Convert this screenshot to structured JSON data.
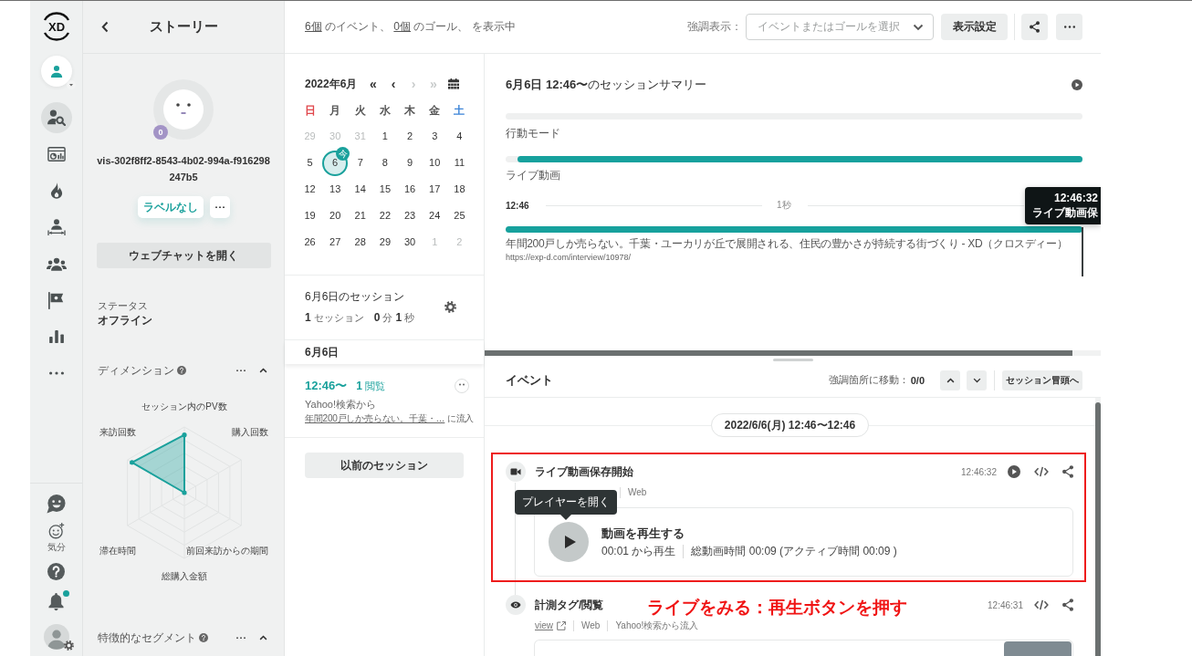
{
  "side_rail": {
    "logo": "XD",
    "nav": [
      {
        "selected": true
      },
      {
        "selected": false
      },
      {
        "selected": false
      },
      {
        "selected": false
      },
      {
        "selected": false
      },
      {
        "selected": false
      },
      {
        "selected": false
      },
      {
        "selected": false
      }
    ],
    "mood_label": "気分",
    "unread_notifications": true
  },
  "story_panel": {
    "title": "ストーリー",
    "visitor_id": "vis-302f8ff2-8543-4b02-994a-f916298247b5",
    "visit_count": "0",
    "label_button": "ラベルなし",
    "chat_button": "ウェブチャットを開く",
    "status": {
      "label": "ステータス",
      "value": "オフライン"
    },
    "dimensions": {
      "title": "ディメンション",
      "expanded": true,
      "axes": [
        "セッション内のPV数",
        "購入回数",
        "前回来訪からの期間",
        "総購入金額",
        "滞在時間",
        "来訪回数"
      ]
    },
    "segments": {
      "title": "特徴的なセグメント",
      "expanded": true
    }
  },
  "top_bar": {
    "summary": [
      {
        "kind": "link",
        "text": "6個"
      },
      {
        "kind": "text",
        "text": " のイベント、 "
      },
      {
        "kind": "link",
        "text": "0個"
      },
      {
        "kind": "text",
        "text": " のゴール、 を表示中"
      }
    ],
    "highlight_label": "強調表示：",
    "highlight_select": {
      "placeholder": "イベントまたはゴールを選択"
    },
    "settings_button": "表示設定"
  },
  "calendar": {
    "title": "2022年6月",
    "nav": [
      {
        "text": "«",
        "disabled": false
      },
      {
        "text": "‹",
        "disabled": false
      },
      {
        "text": "›",
        "disabled": true
      },
      {
        "text": "»",
        "disabled": true
      }
    ],
    "weekdays": [
      {
        "text": "日",
        "color": "#e0474c"
      },
      {
        "text": "月",
        "color": "#555555"
      },
      {
        "text": "火",
        "color": "#555555"
      },
      {
        "text": "水",
        "color": "#555555"
      },
      {
        "text": "木",
        "color": "#555555"
      },
      {
        "text": "金",
        "color": "#555555"
      },
      {
        "text": "土",
        "color": "#3d85d8"
      }
    ],
    "today_badge": "今",
    "days": [
      {
        "text": "29",
        "outside": true,
        "selected": false,
        "today": false
      },
      {
        "text": "30",
        "outside": true,
        "selected": false,
        "today": false
      },
      {
        "text": "31",
        "outside": true,
        "selected": false,
        "today": false
      },
      {
        "text": "1",
        "outside": false,
        "selected": false,
        "today": false
      },
      {
        "text": "2",
        "outside": false,
        "selected": false,
        "today": false
      },
      {
        "text": "3",
        "outside": false,
        "selected": false,
        "today": false
      },
      {
        "text": "4",
        "outside": false,
        "selected": false,
        "today": false
      },
      {
        "text": "5",
        "outside": false,
        "selected": false,
        "today": false
      },
      {
        "text": "6",
        "outside": false,
        "selected": true,
        "today": true
      },
      {
        "text": "7",
        "outside": false,
        "selected": false,
        "today": false
      },
      {
        "text": "8",
        "outside": false,
        "selected": false,
        "today": false
      },
      {
        "text": "9",
        "outside": false,
        "selected": false,
        "today": false
      },
      {
        "text": "10",
        "outside": false,
        "selected": false,
        "today": false
      },
      {
        "text": "11",
        "outside": false,
        "selected": false,
        "today": false
      },
      {
        "text": "12",
        "outside": false,
        "selected": false,
        "today": false
      },
      {
        "text": "13",
        "outside": false,
        "selected": false,
        "today": false
      },
      {
        "text": "14",
        "outside": false,
        "selected": false,
        "today": false
      },
      {
        "text": "15",
        "outside": false,
        "selected": false,
        "today": false
      },
      {
        "text": "16",
        "outside": false,
        "selected": false,
        "today": false
      },
      {
        "text": "17",
        "outside": false,
        "selected": false,
        "today": false
      },
      {
        "text": "18",
        "outside": false,
        "selected": false,
        "today": false
      },
      {
        "text": "19",
        "outside": false,
        "selected": false,
        "today": false
      },
      {
        "text": "20",
        "outside": false,
        "selected": false,
        "today": false
      },
      {
        "text": "21",
        "outside": false,
        "selected": false,
        "today": false
      },
      {
        "text": "22",
        "outside": false,
        "selected": false,
        "today": false
      },
      {
        "text": "23",
        "outside": false,
        "selected": false,
        "today": false
      },
      {
        "text": "24",
        "outside": false,
        "selected": false,
        "today": false
      },
      {
        "text": "25",
        "outside": false,
        "selected": false,
        "today": false
      },
      {
        "text": "26",
        "outside": false,
        "selected": false,
        "today": false
      },
      {
        "text": "27",
        "outside": false,
        "selected": false,
        "today": false
      },
      {
        "text": "28",
        "outside": false,
        "selected": false,
        "today": false
      },
      {
        "text": "29",
        "outside": false,
        "selected": false,
        "today": false
      },
      {
        "text": "30",
        "outside": false,
        "selected": false,
        "today": false
      },
      {
        "text": "1",
        "outside": true,
        "selected": false,
        "today": false
      },
      {
        "text": "2",
        "outside": true,
        "selected": false,
        "today": false
      }
    ]
  },
  "sessions": {
    "title": "6月6日のセッション",
    "stats": "**1** セッション　**0** 分 **1** 秒",
    "date": "6月6日",
    "items": [
      {
        "time": "12:46〜",
        "views": "**1** 閲覧",
        "source": "Yahoo!検索から",
        "landing_link": "年間200戸しか売らない。千葉・…",
        "landing_suffix": "に流入"
      }
    ],
    "previous_button": "以前のセッション"
  },
  "session_summary": {
    "title": "**6月6日 12:46〜**のセッションサマリー",
    "tracks": [
      {
        "label": "行動モード"
      },
      {
        "label": "ライブ動画",
        "level": 0.98
      }
    ],
    "timeline": {
      "start": "12:46",
      "scale": "1秒"
    },
    "page": {
      "title": "年間200戸しか売らない。千葉・ユーカリが丘で展開される、住民の豊かさが持続する街づくり - XD（クロスディー）",
      "url": "https://exp-d.com/interview/10978/"
    },
    "cursor": {
      "time": "12:46:32",
      "event": "ライブ動画保"
    }
  },
  "events": {
    "title": "イベント",
    "jump_label": "強調箇所に移動：",
    "jump_count": "0/0",
    "top_button": "セッション冒頭へ",
    "date": "2022/6/6(月) 12:46〜12:46",
    "items": [
      {
        "kind": "video",
        "title": "ライブ動画保存開始",
        "time": "12:46:32",
        "replay": true,
        "highlighted": true,
        "meta": [
          "Web"
        ],
        "tooltip": "プレイヤーを開く",
        "player": {
          "title": "動画を再生する",
          "start": "00:01 から再生",
          "duration": "総動画時間 00:09 (アクティブ時間 00:09 )"
        }
      },
      {
        "kind": "pageview",
        "title": "計測タグ/閲覧",
        "time": "12:46:31",
        "replay": false,
        "highlighted": false,
        "link": "view",
        "meta": [
          "Web",
          "Yahoo!検索から流入"
        ],
        "preview": {
          "thumbnail": true
        }
      }
    ]
  },
  "annotation": {
    "text": "ライブをみる：再生ボタンを押す"
  }
}
